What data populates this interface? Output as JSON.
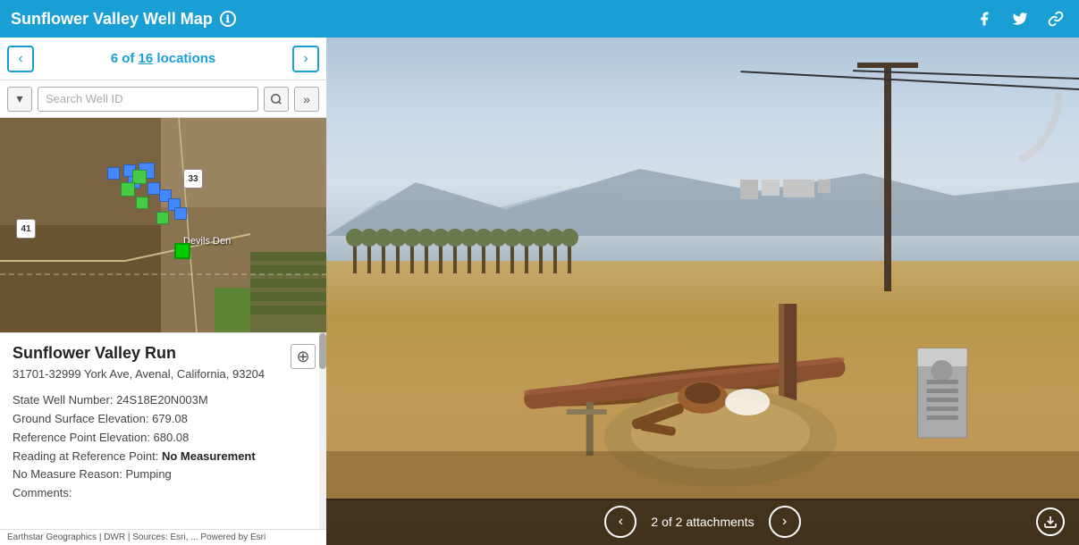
{
  "header": {
    "title": "Sunflower Valley Well Map",
    "info_icon": "ℹ",
    "social_icons": [
      "facebook",
      "twitter",
      "link"
    ],
    "bg_color": "#1a9fd4"
  },
  "nav": {
    "current": "6",
    "total": "16",
    "label": " of ",
    "unit": " locations",
    "prev_arrow": "‹",
    "next_arrow": "›"
  },
  "search": {
    "placeholder": "Search Well ID",
    "collapse_icon": "▾",
    "search_icon": "⌕",
    "forward_icon": "»"
  },
  "info_panel": {
    "title": "Sunflower Valley Run",
    "address": "31701-32999 York Ave, Avenal, California, 93204",
    "state_well_number": "State Well Number: 24S18E20N003M",
    "ground_elevation": "Ground Surface Elevation: 679.08",
    "ref_elevation": "Reference Point Elevation: 680.08",
    "reading_label": "Reading at Reference Point:",
    "reading_value": "No Measurement",
    "no_measure_label": "No Measure Reason:",
    "no_measure_value": "Pumping",
    "comments_label": "Comments:",
    "zoom_icon": "⊕"
  },
  "map": {
    "route_33": "33",
    "route_41": "41",
    "devils_den": "Devils Den",
    "attribution": "Earthstar Geographics | DWR | Sources: Esri, ...   Powered by Esri"
  },
  "photo": {
    "attachment_text": "2 of 2 attachments",
    "prev_arrow": "‹",
    "next_arrow": "›",
    "download_icon": "↓"
  }
}
